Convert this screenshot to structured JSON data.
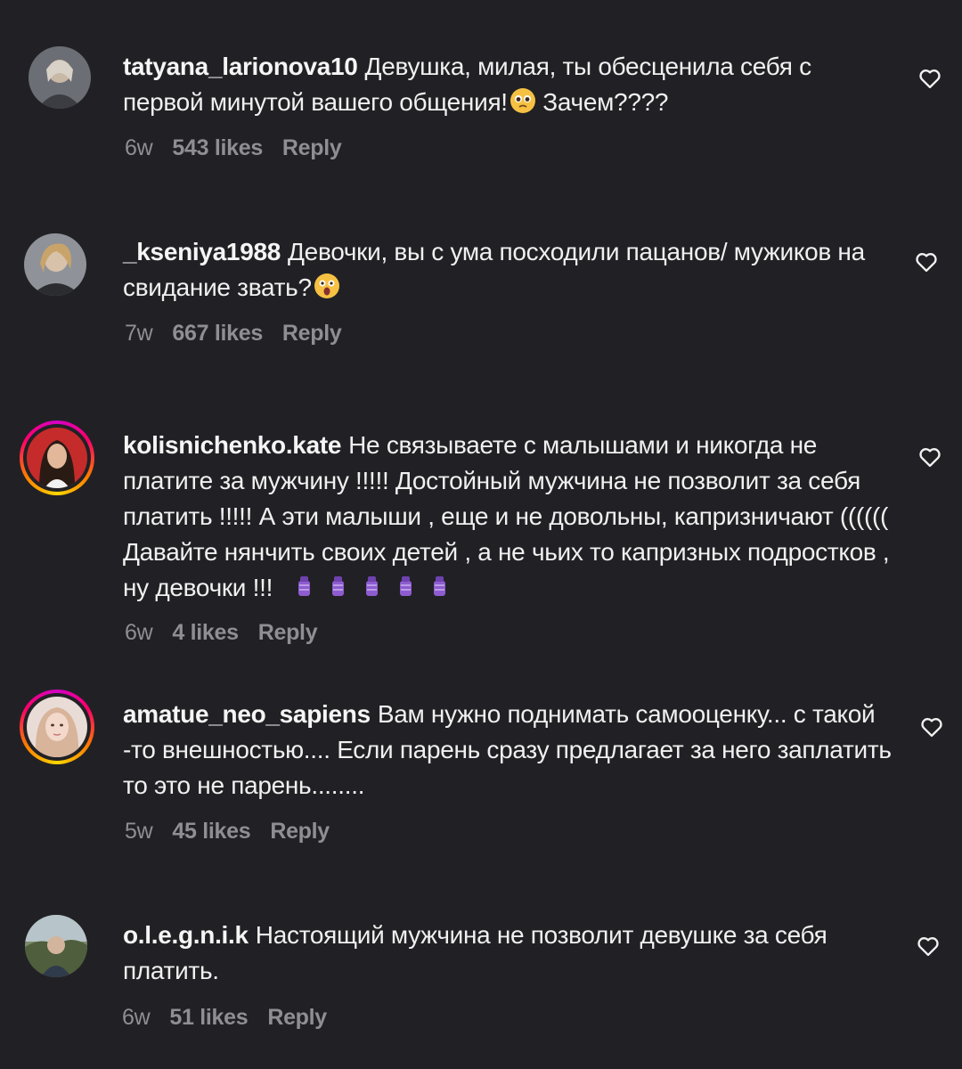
{
  "comments": [
    {
      "username": "tatyana_larionova10",
      "text_before_emoji": "Девушка, милая, ты обесценила себя с первой минутой вашего общения!",
      "emoji": "pleading-face",
      "text_after_emoji": " Зачем????",
      "time": "6w",
      "likes": "543 likes",
      "reply": "Reply"
    },
    {
      "username": "_kseniya1988",
      "text_before_emoji": "Девочки, вы с ума посходили пацанов/ мужиков на свидание звать?",
      "emoji": "astonished-face",
      "text_after_emoji": "",
      "time": "7w",
      "likes": "667 likes",
      "reply": "Reply"
    },
    {
      "username": "kolisnichenko.kate",
      "text_before_emoji": "Не связываете с малышами и никогда не платите за мужчину !!!!! Достойный мужчина не позволит за себя платить !!!!! А эти малыши , еще и не довольны, капризничают (((((( Давайте нянчить своих детей , а не чьих то капризных подростков , ну девочки !!!",
      "emoji": "baby-bottle x5",
      "text_after_emoji": "",
      "time": "6w",
      "likes": "4 likes",
      "reply": "Reply"
    },
    {
      "username": "amatue_neo_sapiens",
      "text_before_emoji": "Вам нужно поднимать самооценку... с такой -то внешностью.... Если парень сразу предлагает за него заплатить то это не парень........",
      "emoji": "",
      "text_after_emoji": "",
      "time": "5w",
      "likes": "45 likes",
      "reply": "Reply"
    },
    {
      "username": "o.l.e.g.n.i.k",
      "text_before_emoji": "Настоящий мужчина не позволит девушке за себя платить.",
      "emoji": "",
      "text_after_emoji": "",
      "time": "6w",
      "likes": "51 likes",
      "reply": "Reply"
    }
  ],
  "colors": {
    "background": "#212125",
    "text": "#f2f2f2",
    "meta": "#8e8e93",
    "story_ring": "#ff0069"
  },
  "icons": {
    "like": "heart-outline-icon"
  }
}
